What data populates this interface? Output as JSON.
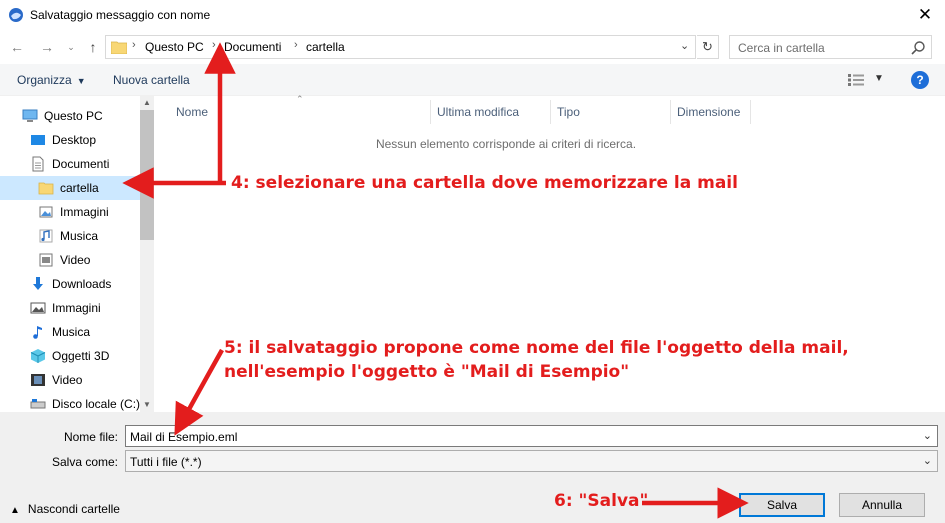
{
  "window": {
    "title": "Salvataggio messaggio con nome",
    "close_label": "✕"
  },
  "address": {
    "crumbs": [
      "Questo PC",
      "Documenti",
      "cartella"
    ]
  },
  "search": {
    "placeholder": "Cerca in cartella"
  },
  "toolbar": {
    "organize_label": "Organizza",
    "new_folder_label": "Nuova cartella"
  },
  "sidebar": {
    "items": [
      {
        "label": "Questo PC",
        "icon": "computer-icon"
      },
      {
        "label": "Desktop",
        "icon": "desktop-icon"
      },
      {
        "label": "Documenti",
        "icon": "documents-icon"
      },
      {
        "label": "cartella",
        "icon": "folder-icon",
        "selected": true
      },
      {
        "label": "Immagini",
        "icon": "pictures-icon"
      },
      {
        "label": "Musica",
        "icon": "music-icon"
      },
      {
        "label": "Video",
        "icon": "video-icon"
      },
      {
        "label": "Downloads",
        "icon": "downloads-icon"
      },
      {
        "label": "Immagini",
        "icon": "pictures-icon"
      },
      {
        "label": "Musica",
        "icon": "music-icon"
      },
      {
        "label": "Oggetti 3D",
        "icon": "objects-3d-icon"
      },
      {
        "label": "Video",
        "icon": "video-icon"
      },
      {
        "label": "Disco locale (C:)",
        "icon": "drive-icon"
      }
    ]
  },
  "file_list": {
    "columns": [
      "Nome",
      "Ultima modifica",
      "Tipo",
      "Dimensione"
    ],
    "empty_message": "Nessun elemento corrisponde ai criteri di ricerca."
  },
  "form": {
    "filename_label": "Nome file:",
    "filename_value": "Mail di Esempio.eml",
    "filetype_label": "Salva come:",
    "filetype_value": "Tutti i file (*.*)"
  },
  "footer": {
    "hide_folders_label": "Nascondi cartelle",
    "save_label": "Salva",
    "cancel_label": "Annulla"
  },
  "annotations": {
    "step4": "4: selezionare una cartella dove memorizzare la mail",
    "step5_line1": "5: il salvataggio propone come nome del file l'oggetto della mail,",
    "step5_line2": "nell'esempio l'oggetto è \"Mail di Esempio\"",
    "step6": "6: \"Salva\""
  },
  "colors": {
    "accent": "#0078d7",
    "annotation": "#e31d1d",
    "selected_row": "#cce8ff"
  }
}
